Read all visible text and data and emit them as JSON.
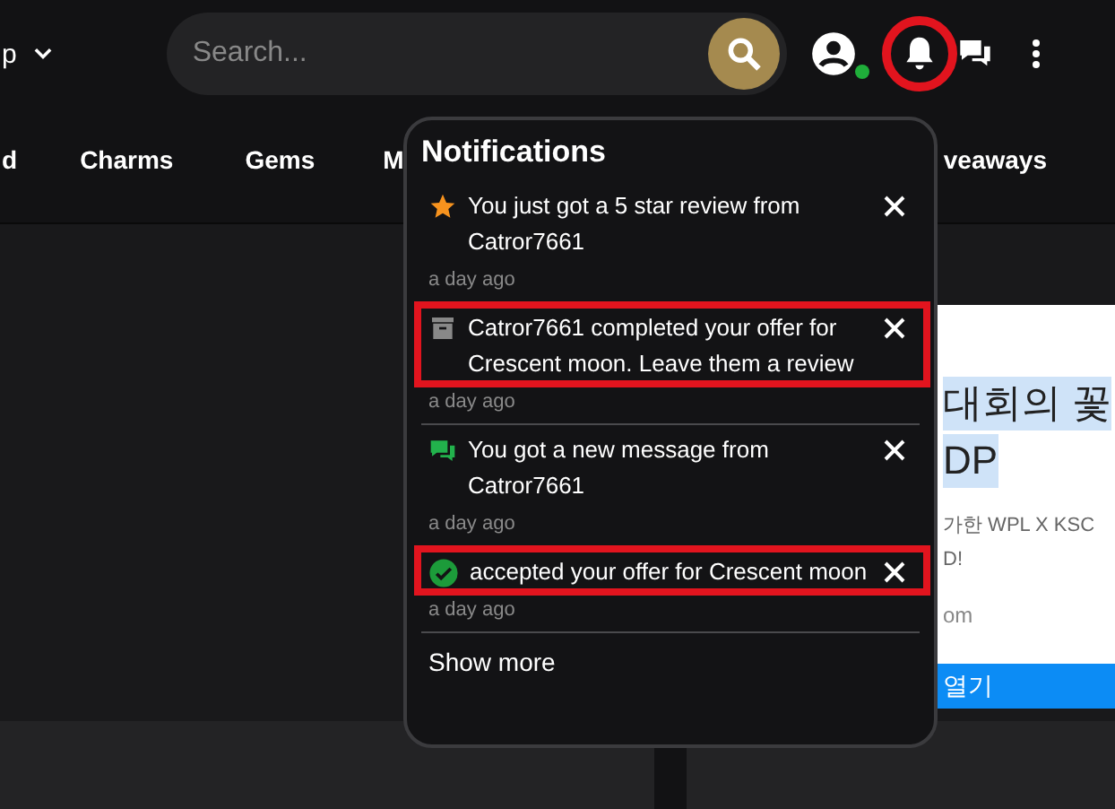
{
  "header": {
    "menu_label": "p",
    "search": {
      "placeholder": "Search..."
    },
    "status_online": true,
    "bell_highlighted": true
  },
  "nav": {
    "items_left": [
      "d",
      "Charms",
      "Gems",
      "M"
    ],
    "items_right": [
      "veaways"
    ]
  },
  "notifications": {
    "title": "Notifications",
    "items": [
      {
        "kind": "review",
        "text": "You just got a 5 star review from Catror7661",
        "time": "a day ago",
        "highlighted": false
      },
      {
        "kind": "offer",
        "text": "Catror7661 completed your offer for Crescent moon. Leave them a review",
        "time": "a day ago",
        "highlighted": true
      },
      {
        "kind": "message",
        "text": "You got a new message from Catror7661",
        "time": "a day ago",
        "highlighted": false
      },
      {
        "kind": "accepted",
        "text": "accepted your offer for Crescent moon",
        "time": "a day ago",
        "highlighted": true
      }
    ],
    "more": "Show more"
  },
  "ad": {
    "headline": [
      "대회의 꽃",
      "DP"
    ],
    "body": [
      "가한 WPL X KSC",
      "D!"
    ],
    "site": "om",
    "button": "열기"
  }
}
